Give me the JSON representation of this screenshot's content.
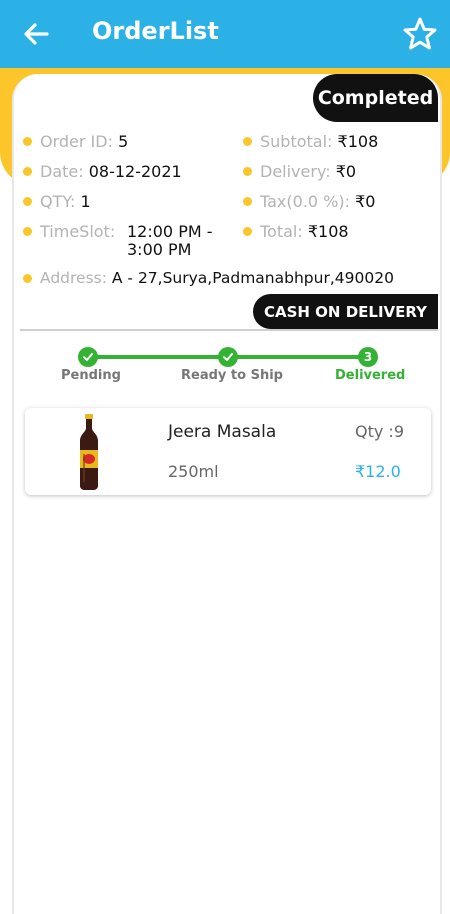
{
  "header": {
    "title": "OrderList",
    "back_icon": "back-arrow-icon",
    "favorite_icon": "star-icon"
  },
  "order": {
    "status": "Completed",
    "order_id_label": "Order ID:",
    "order_id": "5",
    "subtotal_label": "Subtotal:",
    "subtotal": "₹108",
    "date_label": "Date:",
    "date": "08-12-2021",
    "delivery_label": "Delivery:",
    "delivery": "₹0",
    "qty_label": "QTY:",
    "qty": "1",
    "tax_label": "Tax(0.0 %):",
    "tax": "₹0",
    "timeslot_label": "TimeSlot:",
    "timeslot_line1": "12:00 PM -",
    "timeslot_line2": "3:00 PM",
    "total_label": "Total:",
    "total": "₹108",
    "address_label": "Address:",
    "address": "A - 27,Surya,Padmanabhpur,490020",
    "payment_method": "CASH ON DELIVERY"
  },
  "tracking": {
    "steps": [
      {
        "label": "Pending",
        "marker": "check-icon"
      },
      {
        "label": "Ready to Ship",
        "marker": "check-icon"
      },
      {
        "label": "Delivered",
        "marker": "3"
      }
    ]
  },
  "items": [
    {
      "name": "Jeera Masala",
      "qty": "Qty :9",
      "size": "250ml",
      "price": "₹12.0",
      "image_icon": "soda-bottle-icon"
    }
  ],
  "colors": {
    "appbar": "#2bb1e6",
    "accent_yellow": "#fcc52a",
    "badge_dark": "#111111",
    "progress_green": "#34b233",
    "price_blue": "#2bb1e6"
  }
}
